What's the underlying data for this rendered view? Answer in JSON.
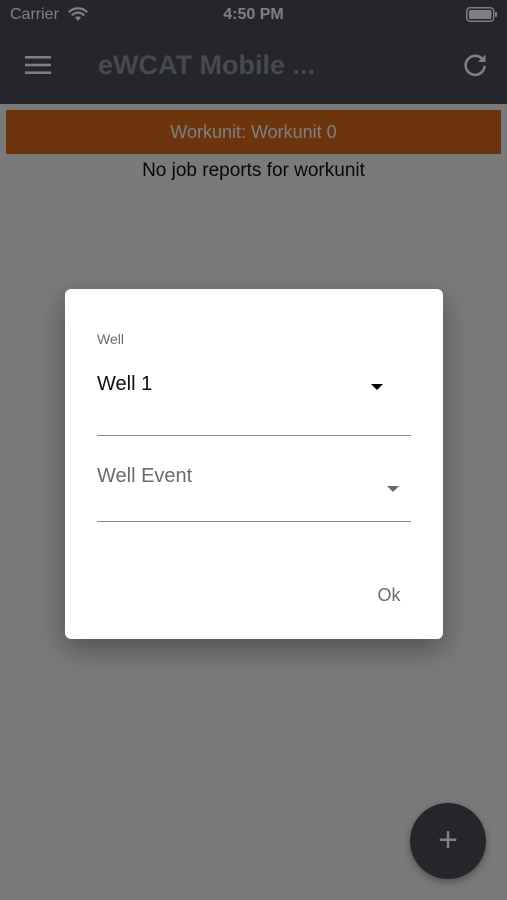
{
  "status_bar": {
    "carrier": "Carrier",
    "time": "4:50 PM",
    "icons": [
      "wifi-icon",
      "battery-icon"
    ]
  },
  "app_bar": {
    "title": "eWCAT Mobile ...",
    "menu_icon": "menu-icon",
    "refresh_icon": "refresh-icon"
  },
  "content": {
    "workunit_banner": "Workunit: Workunit 0",
    "empty_message": "No job reports for workunit"
  },
  "fab": {
    "symbol": "+",
    "icon": "plus-icon"
  },
  "dialog": {
    "well_label": "Well",
    "well_value": "Well 1",
    "well_event_placeholder": "Well Event",
    "ok_label": "Ok"
  },
  "colors": {
    "app_bar": "#4a4c57",
    "banner": "#d96a1a",
    "scrim": "rgba(0,0,0,0.5)",
    "dialog_bg": "#ffffff"
  }
}
